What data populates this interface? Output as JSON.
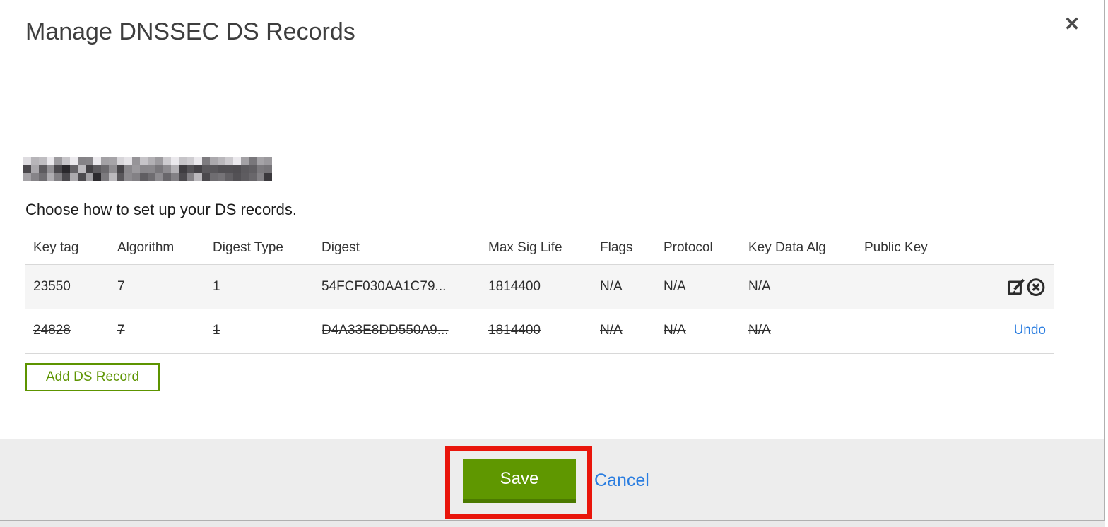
{
  "modal": {
    "title": "Manage DNSSEC DS Records",
    "close_icon": "✕",
    "instruction": "Choose how to set up your DS records.",
    "domain_redacted": true
  },
  "table": {
    "columns": {
      "key_tag": "Key tag",
      "algorithm": "Algorithm",
      "digest_type": "Digest Type",
      "digest": "Digest",
      "max_sig_life": "Max Sig Life",
      "flags": "Flags",
      "protocol": "Protocol",
      "key_data_alg": "Key Data Alg",
      "public_key": "Public Key"
    },
    "rows": [
      {
        "key_tag": "23550",
        "algorithm": "7",
        "digest_type": "1",
        "digest": "54FCF030AA1C79...",
        "max_sig_life": "1814400",
        "flags": "N/A",
        "protocol": "N/A",
        "key_data_alg": "N/A",
        "public_key": "",
        "state": "normal",
        "actions": [
          "edit-icon",
          "delete-icon"
        ]
      },
      {
        "key_tag": "24828",
        "algorithm": "7",
        "digest_type": "1",
        "digest": "D4A33E8DD550A9...",
        "max_sig_life": "1814400",
        "flags": "N/A",
        "protocol": "N/A",
        "key_data_alg": "N/A",
        "public_key": "",
        "state": "deleted",
        "undo_label": "Undo"
      }
    ]
  },
  "buttons": {
    "add_ds_record": "Add DS Record",
    "save": "Save",
    "cancel": "Cancel"
  },
  "colors": {
    "action_green": "#5f9700",
    "action_green_dark": "#4b7a00",
    "add_button_green": "#5d9400",
    "link_blue": "#2a7de0",
    "annotation_red": "#e9150b",
    "footer_gray": "#ededed",
    "row_highlight_gray": "#f5f5f5",
    "divider_gray": "#d8d8d8"
  }
}
